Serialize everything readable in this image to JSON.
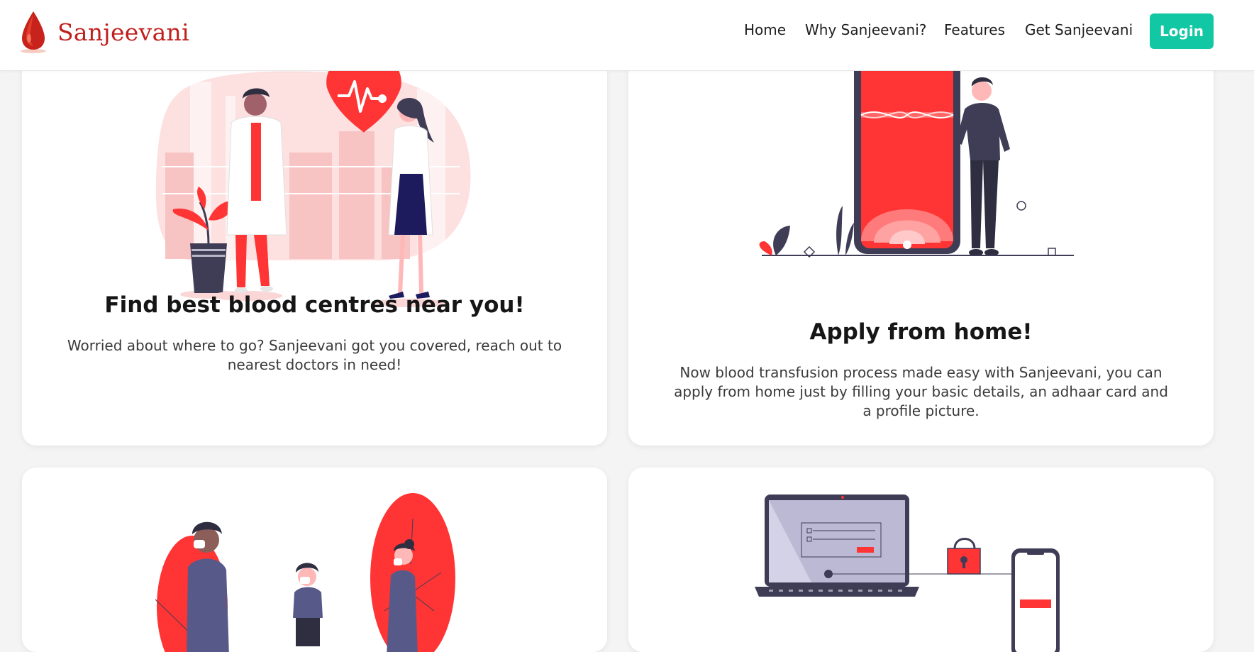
{
  "brand": {
    "name": "Sanjeevani"
  },
  "nav": {
    "items": [
      "Home",
      "Why Sanjeevani?",
      "Features",
      "Get Sanjeevani"
    ],
    "login_label": "Login"
  },
  "colors": {
    "accent": "#12c7a3",
    "brand_red": "#c0201d",
    "illustration_red": "#ff3434",
    "background": "#f4f4f4"
  },
  "cards": [
    {
      "title": "Find best blood centres near you!",
      "text": "Worried about where to go? Sanjeevani got you covered, reach out to nearest doctors in need!",
      "illustration": "doctors-heart-illustration"
    },
    {
      "title": "Apply from home!",
      "text": "Now blood transfusion process made easy with Sanjeevani, you can apply from home just by filling your basic details, an adhaar card and a profile picture.",
      "illustration": "phone-man-illustration"
    },
    {
      "illustration": "people-masks-illustration"
    },
    {
      "illustration": "secure-login-illustration"
    }
  ]
}
